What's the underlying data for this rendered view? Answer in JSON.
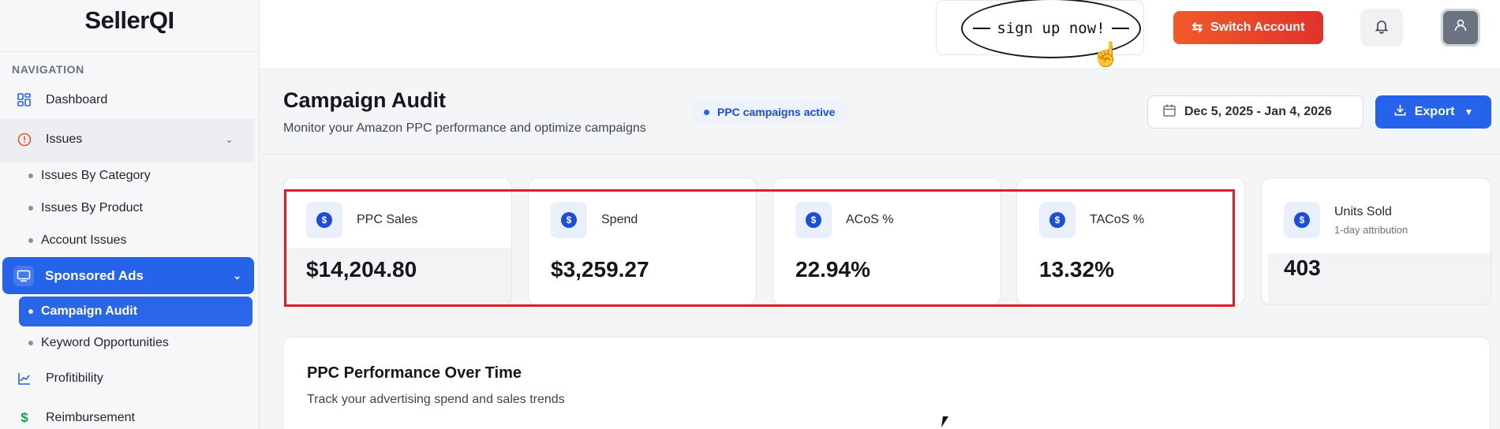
{
  "app": {
    "logo_text": "SellerQI"
  },
  "sidebar": {
    "heading": "NAVIGATION",
    "items": [
      {
        "label": "Dashboard",
        "icon": "grid-icon"
      },
      {
        "label": "Issues",
        "icon": "alert-circle-icon"
      },
      {
        "label": "Issues By Category"
      },
      {
        "label": "Issues By Product"
      },
      {
        "label": "Account Issues"
      },
      {
        "label": "Sponsored Ads",
        "icon": "monitor-icon"
      },
      {
        "label": "Campaign Audit"
      },
      {
        "label": "Keyword Opportunities"
      },
      {
        "label": "Profitibility",
        "icon": "chart-line-icon"
      },
      {
        "label": "Reimbursement",
        "icon": "dollar-icon"
      }
    ]
  },
  "topbar": {
    "promo_text": "sign up now!",
    "switch_account_label": "Switch Account"
  },
  "page": {
    "title": "Campaign Audit",
    "subtitle": "Monitor your Amazon PPC performance and optimize campaigns",
    "status_badge": "PPC campaigns active",
    "date_range": "Dec 5, 2025 - Jan 4, 2026",
    "export_label": "Export"
  },
  "metrics": [
    {
      "label": "PPC Sales",
      "value": "$14,204.80",
      "sublabel": ""
    },
    {
      "label": "Spend",
      "value": "$3,259.27",
      "sublabel": ""
    },
    {
      "label": "ACoS %",
      "value": "22.94%",
      "sublabel": ""
    },
    {
      "label": "TACoS %",
      "value": "13.32%",
      "sublabel": ""
    },
    {
      "label": "Units Sold",
      "value": "403",
      "sublabel": "1-day attribution"
    }
  ],
  "chart_section": {
    "title": "PPC Performance Over Time",
    "subtitle": "Track your advertising spend and sales trends"
  },
  "colors": {
    "primary": "#2563eb",
    "switch_account": "#ef4a2a",
    "highlight": "#e11d2a"
  }
}
